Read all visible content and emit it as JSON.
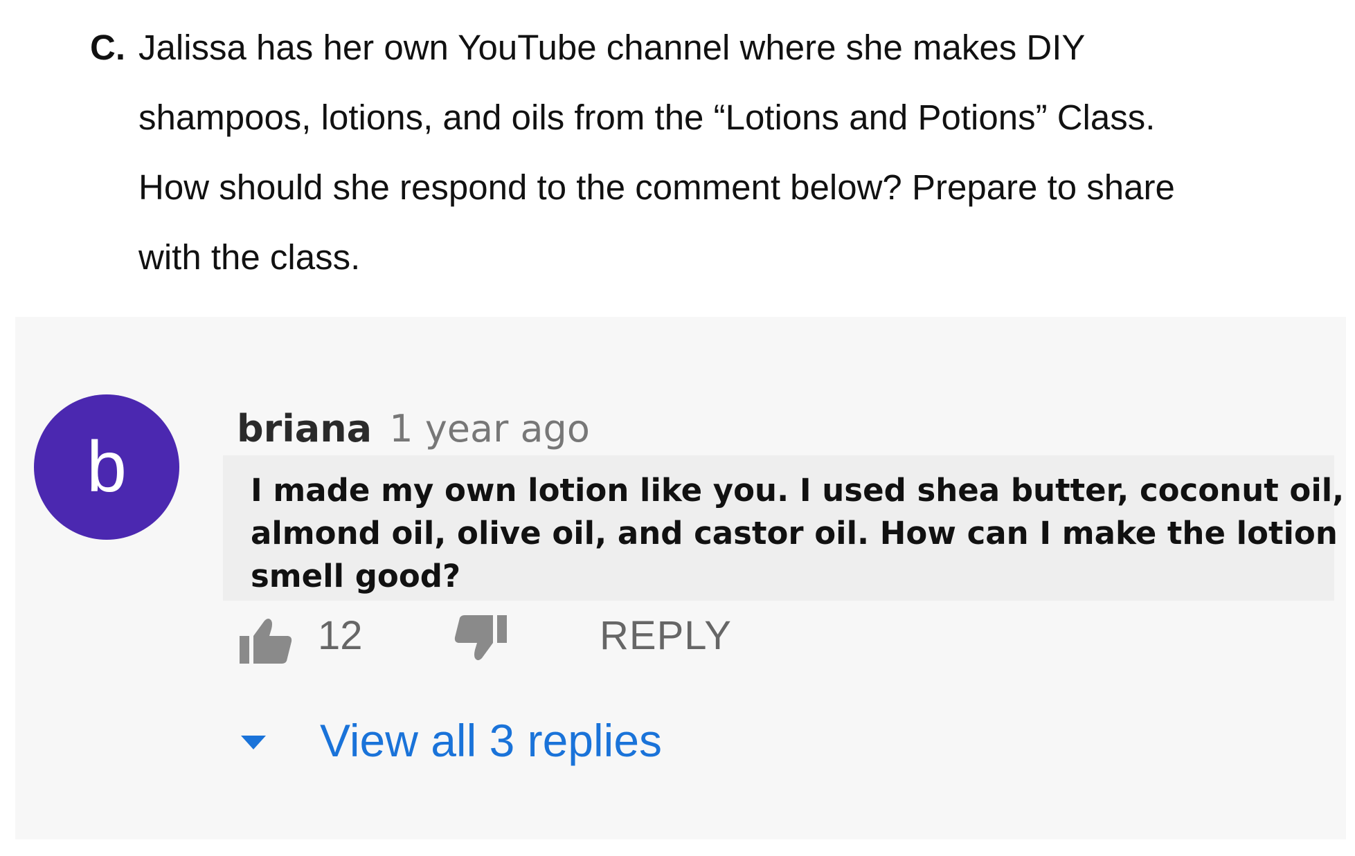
{
  "question": {
    "letter": "C.",
    "lines": [
      "Jalissa has her own YouTube channel where she makes DIY",
      "shampoos, lotions, and oils from the “Lotions and Potions” Class.",
      "How should she respond to the comment below? Prepare to share",
      "with the class."
    ]
  },
  "comment": {
    "avatar_letter": "b",
    "author": "briana",
    "time": "1 year ago",
    "text": "I made my own lotion like you. I used shea butter, coconut oil, almond oil, olive oil, and castor oil. How can I make the lotion smell good?",
    "like_count": "12",
    "reply_label": "REPLY",
    "view_replies_label": "View all 3 replies",
    "colors": {
      "avatar": "#4b28b0",
      "link": "#1a73d9",
      "panel": "#f7f7f7"
    },
    "icons": [
      "thumbs-up-icon",
      "thumbs-down-icon",
      "chevron-down-icon"
    ]
  }
}
